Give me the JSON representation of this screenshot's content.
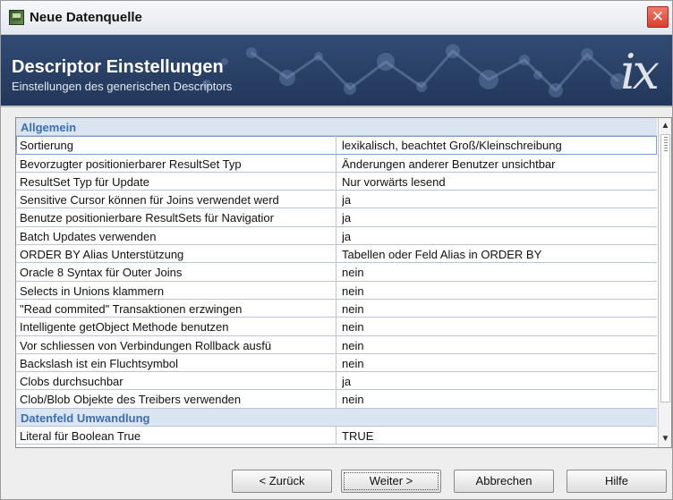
{
  "window": {
    "title": "Neue Datenquelle",
    "close_icon": "close-icon"
  },
  "banner": {
    "title": "Descriptor Einstellungen",
    "subtitle": "Einstellungen des generischen Descriptors",
    "logo": "ix"
  },
  "sections": [
    {
      "label": "Allgemein",
      "rows": [
        {
          "name": "Sortierung",
          "value": "lexikalisch, beachtet Groß/Kleinschreibung"
        },
        {
          "name": "Bevorzugter positionierbarer ResultSet Typ",
          "value": "Änderungen anderer Benutzer unsichtbar"
        },
        {
          "name": "ResultSet Typ für Update",
          "value": "Nur vorwärts lesend"
        },
        {
          "name": "Sensitive Cursor können für Joins verwendet werd",
          "value": "ja"
        },
        {
          "name": "Benutze positionierbare ResultSets für Navigatior",
          "value": "ja"
        },
        {
          "name": "Batch Updates verwenden",
          "value": "ja"
        },
        {
          "name": "ORDER BY Alias Unterstützung",
          "value": "Tabellen oder Feld Alias in ORDER BY"
        },
        {
          "name": "Oracle 8 Syntax für Outer Joins",
          "value": "nein"
        },
        {
          "name": "Selects in Unions klammern",
          "value": "nein"
        },
        {
          "name": "\"Read commited\" Transaktionen erzwingen",
          "value": "nein"
        },
        {
          "name": "Intelligente getObject Methode benutzen",
          "value": "nein"
        },
        {
          "name": "Vor schliessen von Verbindungen Rollback ausfü",
          "value": "nein"
        },
        {
          "name": "Backslash ist ein Fluchtsymbol",
          "value": "nein"
        },
        {
          "name": "Clobs durchsuchbar",
          "value": "ja"
        },
        {
          "name": "Clob/Blob Objekte des Treibers verwenden",
          "value": "nein"
        }
      ]
    },
    {
      "label": "Datenfeld Umwandlung",
      "rows": [
        {
          "name": "Literal für Boolean True",
          "value": "TRUE"
        }
      ]
    }
  ],
  "buttons": {
    "back": "< Zurück",
    "next": "Weiter >",
    "cancel": "Abbrechen",
    "help": "Hilfe"
  },
  "colors": {
    "banner": "#2a4268",
    "section_bg": "#dbe5f2",
    "section_text": "#3c6eb2",
    "close": "#d9402e"
  }
}
